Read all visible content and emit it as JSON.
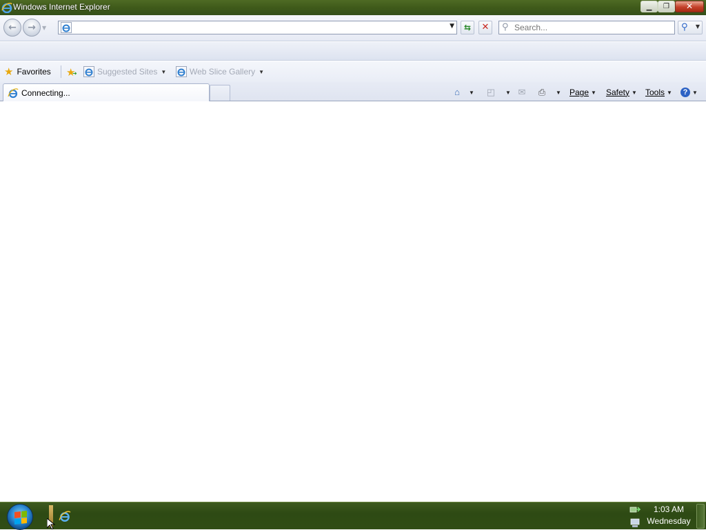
{
  "window": {
    "title": "Windows Internet Explorer"
  },
  "address_bar": {
    "value": ""
  },
  "search": {
    "placeholder": "Search..."
  },
  "favorites_bar": {
    "favorites_label": "Favorites",
    "items": [
      {
        "label": "Suggested Sites"
      },
      {
        "label": "Web Slice Gallery"
      }
    ]
  },
  "tabs": [
    {
      "label": "Connecting..."
    }
  ],
  "command_bar": {
    "page_label": "Page",
    "safety_label": "Safety",
    "tools_label": "Tools"
  },
  "taskbar": {
    "clock_time": "1:03 AM",
    "clock_day": "Wednesday"
  },
  "colors": {
    "titlebar": "#3f5a1a",
    "taskbar": "#2e4a14",
    "chrome": "#e6eaf4"
  }
}
